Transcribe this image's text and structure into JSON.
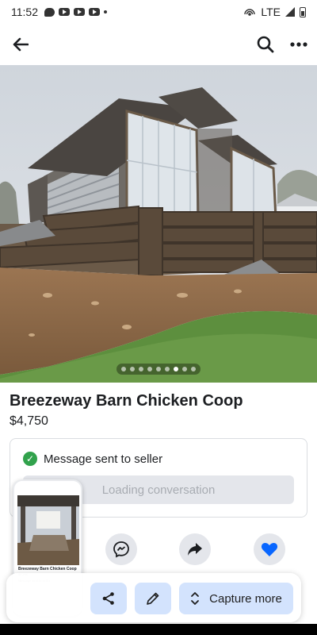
{
  "status_bar": {
    "time": "11:52",
    "network": "LTE"
  },
  "listing": {
    "title": "Breezeway Barn Chicken Coop",
    "price": "$4,750",
    "photo_count": 9,
    "active_photo_index": 6
  },
  "message_card": {
    "status_text": "Message sent to seller",
    "loading_label": "Loading conversation"
  },
  "actions": [
    {
      "name": "message",
      "icon": "messenger-icon"
    },
    {
      "name": "share",
      "icon": "share-arrow-icon"
    },
    {
      "name": "save",
      "icon": "heart-icon"
    }
  ],
  "capture_bar": {
    "capture_more_label": "Capture more",
    "share_icon": "share-icon",
    "edit_icon": "pencil-icon"
  },
  "thumbnail": {
    "title": "Breezeway Barn Chicken Coop",
    "price": "$4,750",
    "message": "Message sent to seller"
  },
  "colors": {
    "accent": "#0866ff",
    "success": "#31a24c",
    "capture_button": "#d3e3fd"
  }
}
